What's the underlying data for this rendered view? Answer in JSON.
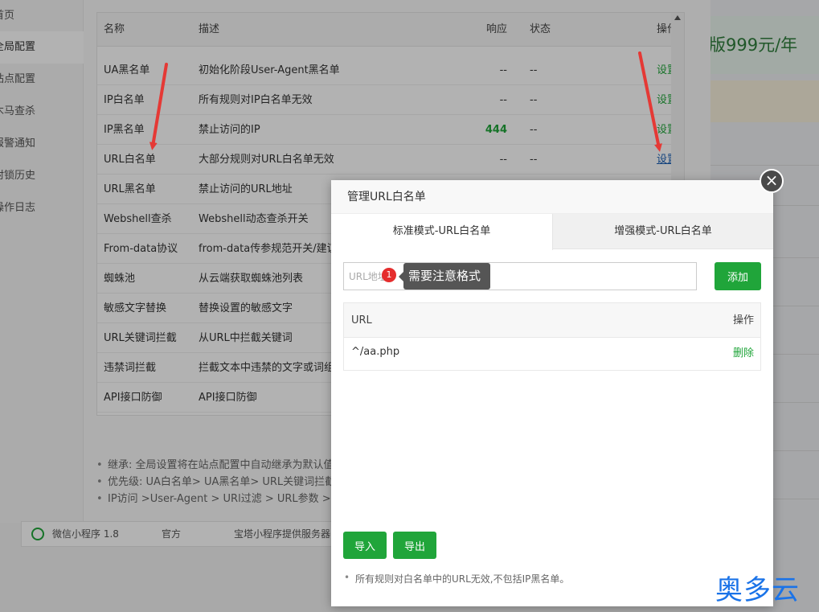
{
  "background": {
    "ad_text": "版999元/年"
  },
  "sidebar": {
    "items": [
      {
        "label": "首页"
      },
      {
        "label": "全局配置"
      },
      {
        "label": "站点配置"
      },
      {
        "label": "木马查杀"
      },
      {
        "label": "报警通知"
      },
      {
        "label": "封锁历史"
      },
      {
        "label": "操作日志"
      }
    ]
  },
  "rules_table": {
    "headers": {
      "name": "名称",
      "desc": "描述",
      "response": "响应",
      "status": "状态",
      "action": "操作"
    },
    "rows": [
      {
        "name": "UA黑名单",
        "desc": "初始化阶段User-Agent黑名单",
        "response": "--",
        "status": "--",
        "action": "设置"
      },
      {
        "name": "IP白名单",
        "desc": "所有规则对IP白名单无效",
        "response": "--",
        "status": "--",
        "action": "设置"
      },
      {
        "name": "IP黑名单",
        "desc": "禁止访问的IP",
        "response": "444",
        "status": "--",
        "action": "设置"
      },
      {
        "name": "URL白名单",
        "desc": "大部分规则对URL白名单无效",
        "response": "--",
        "status": "--",
        "action": "设置"
      },
      {
        "name": "URL黑名单",
        "desc": "禁止访问的URL地址"
      },
      {
        "name": "Webshell查杀",
        "desc": "Webshell动态查杀开关"
      },
      {
        "name": "From-data协议",
        "desc": "from-data传参规范开关/建议"
      },
      {
        "name": "蜘蛛池",
        "desc": "从云端获取蜘蛛池列表"
      },
      {
        "name": "敏感文字替换",
        "desc": "替换设置的敏感文字"
      },
      {
        "name": "URL关键词拦截",
        "desc": "从URL中拦截关键词"
      },
      {
        "name": "违禁词拦截",
        "desc": "拦截文本中违禁的文字或词组"
      },
      {
        "name": "API接口防御",
        "desc": "API接口防御"
      }
    ]
  },
  "notes": [
    "继承: 全局设置将在站点配置中自动继承为默认值",
    "优先级: UA白名单> UA黑名单> URL关键词拦截",
    "IP访问 >User-Agent > URl过滤 > URL参数 > C"
  ],
  "bottom_strip": {
    "app": "微信小程序 1.8",
    "source": "官方",
    "desc": "宝塔小程序提供服务器"
  },
  "dialog": {
    "title": "管理URL白名单",
    "close_symbol": "×",
    "tabs": [
      {
        "label": "标准模式-URL白名单"
      },
      {
        "label": "增强模式-URL白名单"
      }
    ],
    "input_placeholder": "URL地址",
    "tooltip_badge": "1",
    "tooltip_text": "需要注意格式",
    "add_button": "添加",
    "url_table": {
      "header_url": "URL",
      "header_action": "操作",
      "rows": [
        {
          "url": "^/aa.php",
          "action": "删除"
        }
      ]
    },
    "import_button": "导入",
    "export_button": "导出",
    "note": "所有规则对白名单中的URL无效,不包括IP黑名单。"
  },
  "watermark": "奥多云",
  "colors": {
    "accent_green": "#20a53a",
    "annotation_red": "#e53935",
    "watermark_blue": "#1a73e8"
  }
}
